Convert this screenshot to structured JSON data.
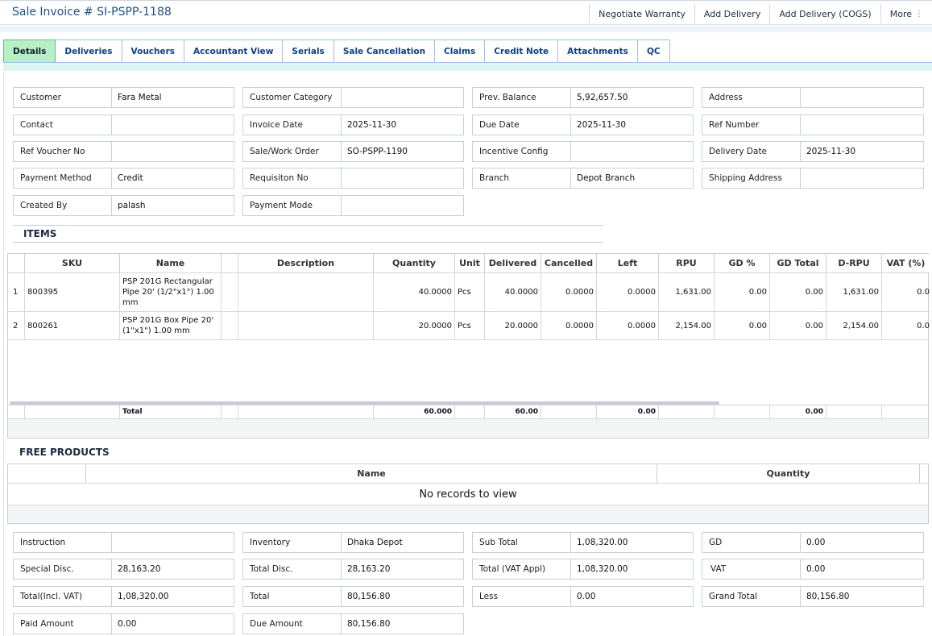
{
  "header": {
    "title": "Sale Invoice # SI-PSPP-1188",
    "actions": [
      "Negotiate Warranty",
      "Add Delivery",
      "Add Delivery (COGS)",
      "More"
    ]
  },
  "tabs": [
    "Details",
    "Deliveries",
    "Vouchers",
    "Accountant View",
    "Serials",
    "Sale Cancellation",
    "Claims",
    "Credit Note",
    "Attachments",
    "QC"
  ],
  "details": {
    "customer": {
      "label": "Customer",
      "value": "Fara Metal"
    },
    "customer_category": {
      "label": "Customer Category",
      "value": ""
    },
    "prev_balance": {
      "label": "Prev. Balance",
      "value": "5,92,657.50"
    },
    "address": {
      "label": "Address",
      "value": ""
    },
    "contact": {
      "label": "Contact",
      "value": ""
    },
    "invoice_date": {
      "label": "Invoice Date",
      "value": "2025-11-30"
    },
    "due_date": {
      "label": "Due Date",
      "value": "2025-11-30"
    },
    "ref_number": {
      "label": "Ref Number",
      "value": ""
    },
    "ref_voucher_no": {
      "label": "Ref Voucher No",
      "value": ""
    },
    "sale_work_order": {
      "label": "Sale/Work Order",
      "value": "SO-PSPP-1190"
    },
    "incentive_config": {
      "label": "Incentive Config",
      "value": ""
    },
    "delivery_date": {
      "label": "Delivery Date",
      "value": "2025-11-30"
    },
    "payment_method": {
      "label": "Payment Method",
      "value": "Credit"
    },
    "requisition_no": {
      "label": "Requisiton No",
      "value": ""
    },
    "branch": {
      "label": "Branch",
      "value": "Depot Branch"
    },
    "shipping_address": {
      "label": "Shipping Address",
      "value": ""
    },
    "created_by": {
      "label": "Created By",
      "value": "palash"
    },
    "payment_mode": {
      "label": "Payment Mode",
      "value": ""
    }
  },
  "items": {
    "title": "ITEMS",
    "columns": [
      "",
      "SKU",
      "Name",
      "",
      "Description",
      "Quantity",
      "Unit",
      "Delivered",
      "Cancelled",
      "Left",
      "RPU",
      "GD %",
      "GD Total",
      "D-RPU",
      "VAT (%)"
    ],
    "rows": [
      {
        "no": "1",
        "sku": "800395",
        "name_line1": "PSP 201G Rectangular",
        "name_line2": "Pipe 20' (1/2\"x1\") 1.00",
        "name_line3": "mm",
        "description": "",
        "quantity": "40.0000",
        "unit": "Pcs",
        "delivered": "40.0000",
        "cancelled": "0.0000",
        "left": "0.0000",
        "rpu": "1,631.00",
        "gd_pct": "0.00",
        "gd_total": "0.00",
        "d_rpu": "1,631.00",
        "vat": "0.0"
      },
      {
        "no": "2",
        "sku": "800261",
        "name_line1": "PSP 201G Box Pipe 20'",
        "name_line2": "(1\"x1\") 1.00 mm",
        "name_line3": "",
        "description": "",
        "quantity": "20.0000",
        "unit": "Pcs",
        "delivered": "20.0000",
        "cancelled": "0.0000",
        "left": "0.0000",
        "rpu": "2,154.00",
        "gd_pct": "0.00",
        "gd_total": "0.00",
        "d_rpu": "2,154.00",
        "vat": "0.0"
      }
    ],
    "total": {
      "label": "Total",
      "quantity": "60.000",
      "delivered": "60.00",
      "left": "0.00",
      "gd_total": "0.00"
    }
  },
  "free_products": {
    "title": "FREE PRODUCTS",
    "columns": [
      "Name",
      "Quantity"
    ],
    "empty": "No records to view"
  },
  "summary": {
    "instruction": {
      "label": "Instruction",
      "value": ""
    },
    "inventory": {
      "label": "Inventory",
      "value": "Dhaka Depot"
    },
    "sub_total": {
      "label": "Sub Total",
      "value": "1,08,320.00"
    },
    "gd": {
      "label": "GD",
      "value": "0.00"
    },
    "special_disc": {
      "label": "Special Disc.",
      "value": "28,163.20"
    },
    "total_disc": {
      "label": "Total Disc.",
      "value": "28,163.20"
    },
    "total_vat_appl": {
      "label": "Total (VAT Appl)",
      "value": "1,08,320.00"
    },
    "vat": {
      "label": "VAT",
      "value": "0.00"
    },
    "total_incl_vat": {
      "label": "Total(Incl. VAT)",
      "value": "1,08,320.00"
    },
    "total": {
      "label": "Total",
      "value": "80,156.80"
    },
    "less": {
      "label": "Less",
      "value": "0.00"
    },
    "grand_total": {
      "label": "Grand Total",
      "value": "80,156.80"
    },
    "paid_amount": {
      "label": "Paid Amount",
      "value": "0.00"
    },
    "due_amount": {
      "label": "Due Amount",
      "value": "80,156.80"
    }
  }
}
